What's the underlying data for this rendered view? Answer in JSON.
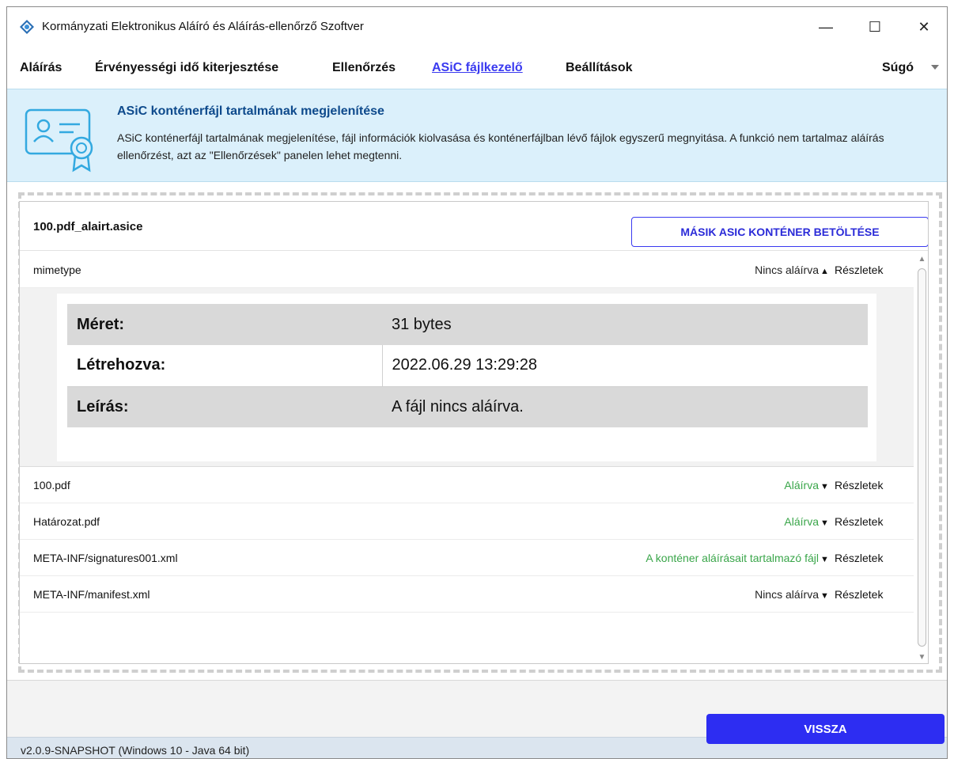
{
  "window": {
    "title": "Kormányzati Elektronikus Aláíró és Aláírás-ellenőrző Szoftver",
    "controls": {
      "minimize": "—",
      "maximize": "☐",
      "close": "✕"
    }
  },
  "menu": {
    "items": [
      {
        "label": "Aláírás"
      },
      {
        "label": "Érvényességi idő kiterjesztése"
      },
      {
        "label": "Ellenőrzés"
      },
      {
        "label": "ASiC fájlkezelő",
        "active": true
      },
      {
        "label": "Beállítások"
      }
    ],
    "help": "Súgó"
  },
  "banner": {
    "title": "ASiC konténerfájl tartalmának megjelenítése",
    "description": "ASiC konténerfájl tartalmának megjelenítése, fájl információk kiolvasása és konténerfájlban lévő fájlok egyszerű megnyitása. A funkció nem tartalmaz aláírás ellenőrzést, azt az \"Ellenőrzések\" panelen lehet megtenni."
  },
  "container": {
    "file_name": "100.pdf_alairt.asice",
    "load_other_button": "MÁSIK ASIC KONTÉNER BETÖLTÉSE"
  },
  "files": [
    {
      "name": "mimetype",
      "status": "Nincs aláírva",
      "details": "Részletek",
      "expanded": true
    },
    {
      "name": "100.pdf",
      "status": "Aláírva",
      "details": "Részletek",
      "expanded": false
    },
    {
      "name": "Határozat.pdf",
      "status": "Aláírva",
      "details": "Részletek",
      "expanded": false
    },
    {
      "name": "META-INF/signatures001.xml",
      "status": "A konténer aláírásait tartalmazó fájl",
      "details": "Részletek",
      "expanded": false
    },
    {
      "name": "META-INF/manifest.xml",
      "status": "Nincs aláírva",
      "details": "Részletek",
      "expanded": false
    }
  ],
  "details": {
    "size_label": "Méret:",
    "size_value": "31 bytes",
    "created_label": "Létrehozva:",
    "created_value": "2022.06.29 13:29:28",
    "description_label": "Leírás:",
    "description_value": "A fájl nincs aláírva."
  },
  "footer": {
    "back_button": "VISSZA",
    "version": "v2.0.9-SNAPSHOT (Windows 10 - Java 64 bit)"
  },
  "colors": {
    "accent": "#2d2df2",
    "banner_bg": "#dbf0fb",
    "signed_status": "#3aa64a",
    "title_blue": "#0e4a8c"
  },
  "icons": {
    "app": "diamond-app-icon",
    "banner": "certificate-icon",
    "expand": "chevron-up-icon",
    "collapse": "chevron-down-icon"
  }
}
